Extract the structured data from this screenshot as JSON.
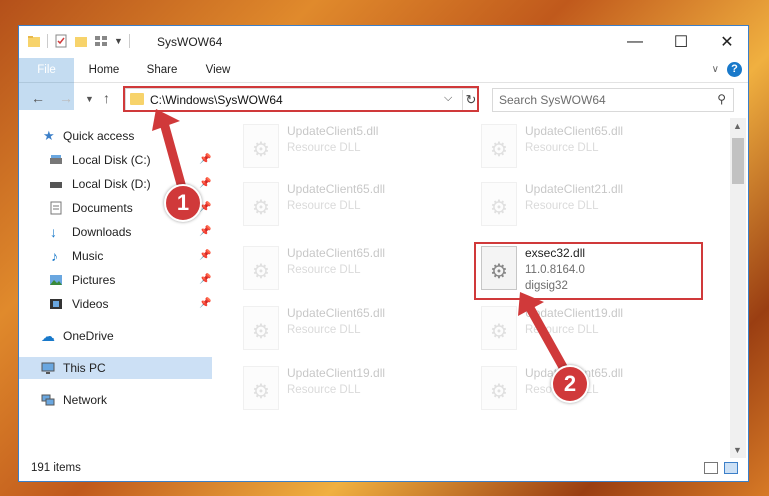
{
  "window": {
    "title": "SysWOW64",
    "controls": {
      "minimize": "—",
      "maximize": "☐",
      "close": "✕"
    }
  },
  "ribbon": {
    "tabs": [
      "File",
      "Home",
      "Share",
      "View"
    ],
    "help": "?"
  },
  "address_bar": {
    "path": "C:\\Windows\\SysWOW64",
    "search_placeholder": "Search SysWOW64"
  },
  "nav_pane": {
    "items": [
      {
        "label": "Quick access",
        "icon": "star-icon"
      },
      {
        "label": "Local Disk (C:)",
        "icon": "drive-icon",
        "pinned": true
      },
      {
        "label": "Local Disk (D:)",
        "icon": "drive-icon",
        "pinned": true
      },
      {
        "label": "Documents",
        "icon": "documents-icon",
        "pinned": true
      },
      {
        "label": "Downloads",
        "icon": "download-icon",
        "pinned": true
      },
      {
        "label": "Music",
        "icon": "music-icon",
        "pinned": true
      },
      {
        "label": "Pictures",
        "icon": "pictures-icon",
        "pinned": true
      },
      {
        "label": "Videos",
        "icon": "videos-icon",
        "pinned": true
      },
      {
        "label": "OneDrive",
        "icon": "cloud-icon"
      },
      {
        "label": "This PC",
        "icon": "pc-icon",
        "selected": true
      },
      {
        "label": "Network",
        "icon": "network-icon"
      }
    ]
  },
  "files": [
    {
      "name": "UpdateClient5.dll",
      "type": "Resource DLL"
    },
    {
      "name": "UpdateClient65.dll",
      "type": "Resource DLL"
    },
    {
      "name": "UpdateClient65.dll",
      "type": "Resource DLL"
    },
    {
      "name": "UpdateClient21.dll",
      "type": "Resource DLL"
    },
    {
      "name": "UpdateClient65.dll",
      "type": "Resource DLL"
    },
    {
      "name": "exsec32.dll",
      "version": "11.0.8164.0",
      "company": "digsig32"
    },
    {
      "name": "UpdateClient65.dll",
      "type": "Resource DLL"
    },
    {
      "name": "UpdateClient19.dll",
      "type": "Resource DLL"
    },
    {
      "name": "UpdateClient19.dll",
      "type": "Resource DLL"
    },
    {
      "name": "UpdateClient65.dll",
      "type": "Resource DLL"
    }
  ],
  "status": {
    "item_count": "191 items"
  },
  "annotations": {
    "step1": "1",
    "step2": "2",
    "highlight_color": "#d0393a"
  }
}
